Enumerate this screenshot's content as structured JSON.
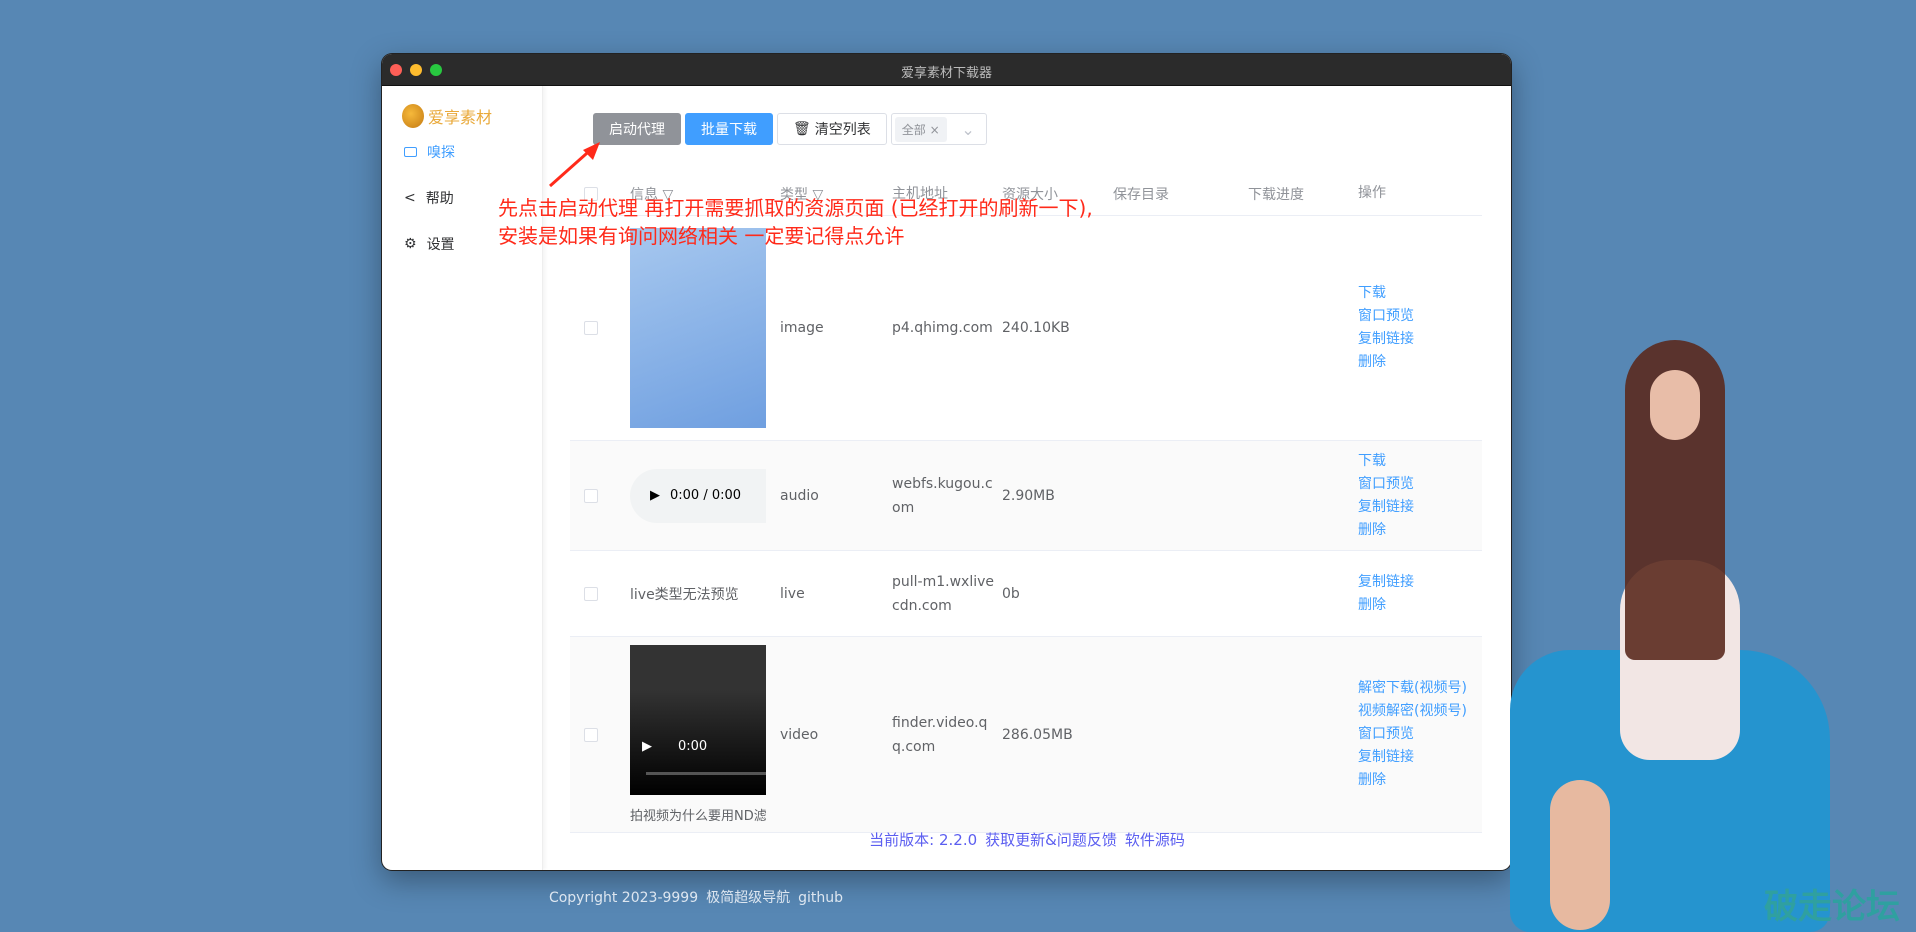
{
  "window": {
    "title": "爱享素材下载器"
  },
  "sidebar": {
    "logo": "爱享素材",
    "items": [
      {
        "label": "嗅探",
        "icon": "video-icon"
      },
      {
        "label": "帮助",
        "icon": "share-icon"
      },
      {
        "label": "设置",
        "icon": "gear-icon"
      }
    ]
  },
  "toolbar": {
    "proxy": "启动代理",
    "batch": "批量下载",
    "clear": "清空列表",
    "filter_tag": "全部"
  },
  "annotation": {
    "line1": "先点击启动代理 再打开需要抓取的资源页面 (已经打开的刷新一下),",
    "line2": "安装是如果有询问网络相关 一定要记得点允许"
  },
  "table": {
    "headers": [
      "信息",
      "类型",
      "主机地址",
      "资源大小",
      "保存目录",
      "下载进度",
      "操作"
    ],
    "rows": [
      {
        "info": "",
        "type": "image",
        "host": "p4.qhimg.com",
        "size": "240.10KB",
        "actions": [
          "下载",
          "窗口预览",
          "复制链接",
          "删除"
        ]
      },
      {
        "info": "0:00 / 0:00",
        "type": "audio",
        "host": "webfs.kugou.com",
        "size": "2.90MB",
        "actions": [
          "下载",
          "窗口预览",
          "复制链接",
          "删除"
        ]
      },
      {
        "info": "live类型无法预览",
        "type": "live",
        "host": "pull-m1.wxlivecdn.com",
        "size": "0b",
        "actions": [
          "复制链接",
          "删除"
        ]
      },
      {
        "info": "0:00",
        "caption": "拍视频为什么要用ND滤",
        "type": "video",
        "host": "finder.video.qq.com",
        "size": "286.05MB",
        "actions": [
          "解密下载(视频号)",
          "视频解密(视频号)",
          "窗口预览",
          "复制链接",
          "删除"
        ]
      }
    ]
  },
  "footer": {
    "version": "当前版本: 2.2.0",
    "update": "获取更新&问题反馈",
    "source": "软件源码"
  },
  "page_footer": {
    "copyright": "Copyright 2023-9999",
    "nav": "极简超级导航",
    "github": "github"
  },
  "watermark": "破走论坛"
}
